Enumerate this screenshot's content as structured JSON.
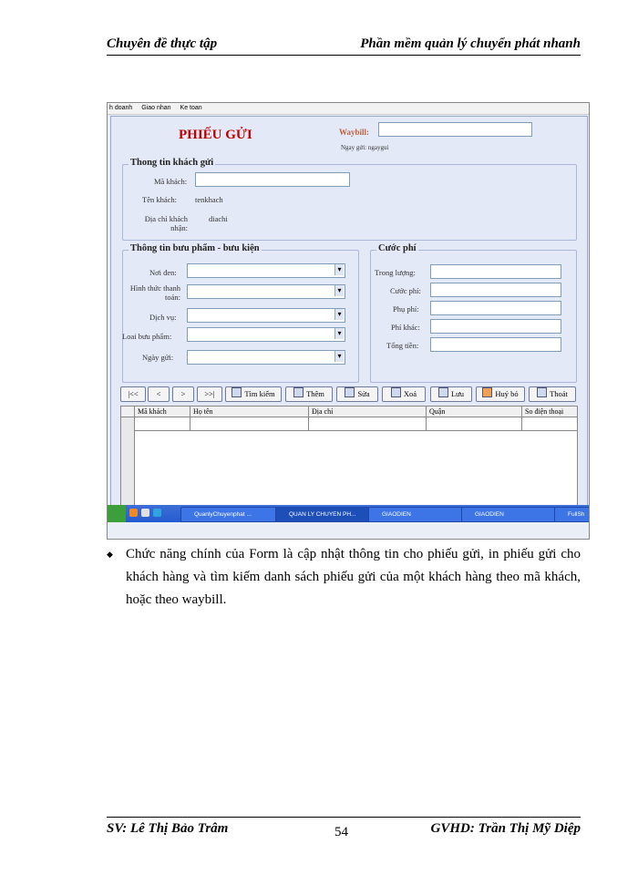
{
  "header": {
    "left": "Chuyên đề thực tập",
    "right": "Phần mềm quản lý chuyển phát nhanh"
  },
  "screenshot": {
    "menu": [
      "h doanh",
      "Giao nhan",
      "Ke toan"
    ],
    "form_title": "PHIẾU GỬI",
    "waybill_label": "Waybill:",
    "ngay_gui_label": "Ngay gửi: ngaygui",
    "customer_group": {
      "title": "Thong tin khách gửi",
      "ma_khach": "Mã khách:",
      "ten_khach": "Tên khách:",
      "ten_khach_value": "tenkhach",
      "dia_chi": "Địa chỉ khách nhận:",
      "dia_chi_value": "diachi"
    },
    "parcel_group": {
      "title": "Thông tin bưu phẩm - bưu kiện",
      "noi_den": "Nơi đen:",
      "hinh_thuc": "Hình thức thanh toán:",
      "dich_vu": "Dịch vụ:",
      "loai_buu_pham": "Loai bưu phẩm:",
      "ngay_gui": "Ngày gửi:"
    },
    "fee_group": {
      "title": "Cước phí",
      "trong_luong": "Trong lượng:",
      "cuoc_phi": "Cước phí:",
      "phu_phi": "Phụ phí:",
      "phi_khac": "Phí khác:",
      "tong_tien": "Tổng tiền:"
    },
    "buttons": {
      "first": "|<<",
      "prev": "<",
      "next": ">",
      "last": ">>|",
      "search": "Tìm kiếm",
      "add": "Thêm",
      "edit": "Sửa",
      "delete": "Xoá",
      "save": "Lưu",
      "cancel": "Huỷ bỏ",
      "exit": "Thoát"
    },
    "grid_columns": [
      "Mã khách",
      "Họ tên",
      "Địa chỉ",
      "Quận",
      "So điện thoại"
    ],
    "taskbar": [
      "QuanlyChuyenphat ...",
      "QUAN LY CHUYEN PH...",
      "GIAODIEN",
      "GIAODIEN",
      "FullSh"
    ]
  },
  "body": {
    "text": "Chức năng chính của Form là cập nhật thông tin cho phiếu gửi, in phiếu gửi cho khách hàng và tìm kiếm danh sách phiếu gửi của một khách hàng theo mã khách, hoặc theo waybill."
  },
  "footer": {
    "left": "SV: Lê Thị Bảo Trâm",
    "page": "54",
    "right": "GVHD: Trần Thị Mỹ Diệp"
  }
}
